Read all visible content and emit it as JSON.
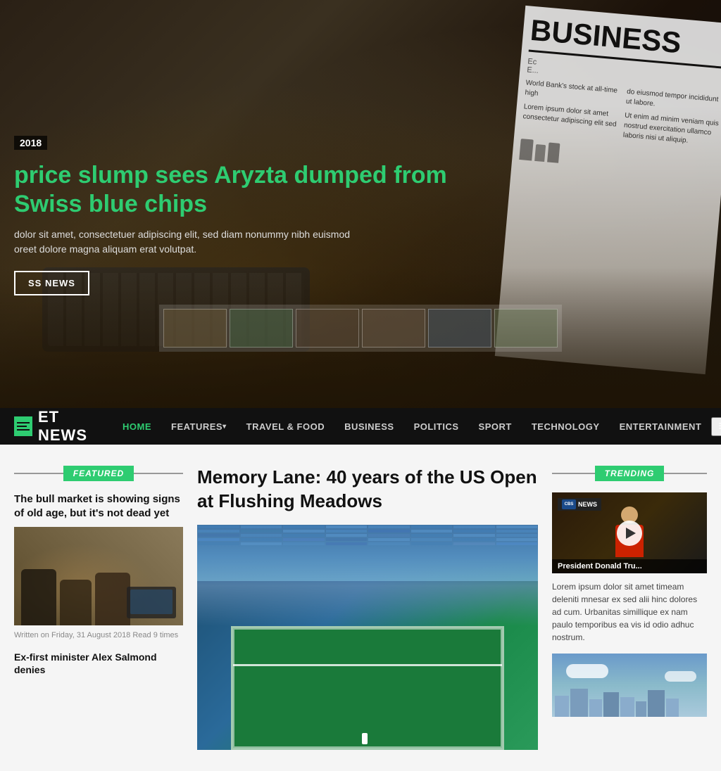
{
  "hero": {
    "date": "2018",
    "headline": "price slump sees Aryzta dumped from Swiss blue chips",
    "subtext_line1": "dolor sit amet, consectetuer adipiscing elit, sed diam nonummy nibh euismod",
    "subtext_line2": "oreet dolore magna aliquam erat volutpat.",
    "cta_label": "SS NEWS",
    "newspaper_title": "BUSINESS",
    "newspaper_subtext": "World Bank's stock at all-time high"
  },
  "navbar": {
    "logo_text": "ET NEWS",
    "items": [
      {
        "label": "HOME",
        "active": true
      },
      {
        "label": "FEATURES",
        "has_arrow": true,
        "active": false
      },
      {
        "label": "TRAVEL & FOOD",
        "active": false
      },
      {
        "label": "BUSINESS",
        "active": false
      },
      {
        "label": "POLITICS",
        "active": false
      },
      {
        "label": "SPORT",
        "active": false
      },
      {
        "label": "TECHNOLOGY",
        "active": false
      },
      {
        "label": "ENTERTAINMENT",
        "active": false
      }
    ]
  },
  "featured": {
    "section_label": "FEATURED",
    "article1": {
      "title": "The bull market is showing signs of old age, but it's not dead yet",
      "meta": "Written on Friday, 31 August 2018 Read 9 times"
    },
    "article2": {
      "title": "Ex-first minister Alex Salmond denies"
    }
  },
  "main_article": {
    "title": "Memory Lane: 40 years of the US Open at Flushing Meadows"
  },
  "trending": {
    "section_label": "TRENDING",
    "video": {
      "badge": "CBS NEWS",
      "title": "President Donald Tru..."
    },
    "description": "Lorem ipsum dolor sit amet timeam deleniti mnesar ex sed alii hinc dolores ad cum. Urbanitas simillique ex nam paulo temporibus ea vis id odio adhuc nostrum."
  }
}
